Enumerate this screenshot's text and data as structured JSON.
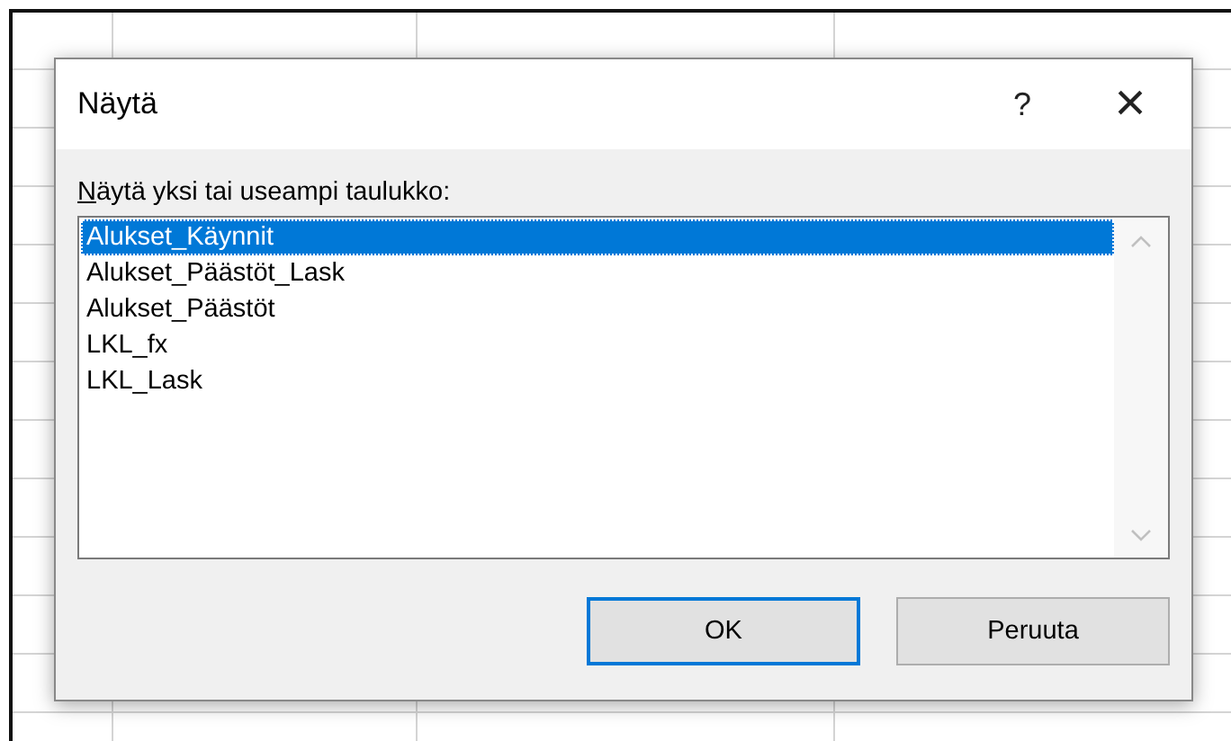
{
  "dialog": {
    "title": "Näytä",
    "help": "?",
    "close": "×"
  },
  "label": {
    "text": "Näytä yksi tai useampi taulukko:",
    "first_letter_underlined": true
  },
  "sheets": [
    {
      "name": "Alukset_Käynnit",
      "selected": true
    },
    {
      "name": "Alukset_Päästöt_Lask",
      "selected": false
    },
    {
      "name": "Alukset_Päästöt",
      "selected": false
    },
    {
      "name": "LKL_fx",
      "selected": false
    },
    {
      "name": "LKL_Lask",
      "selected": false
    }
  ],
  "buttons": [
    {
      "label": "OK",
      "default": true
    },
    {
      "label": "Peruuta",
      "default": false
    }
  ]
}
